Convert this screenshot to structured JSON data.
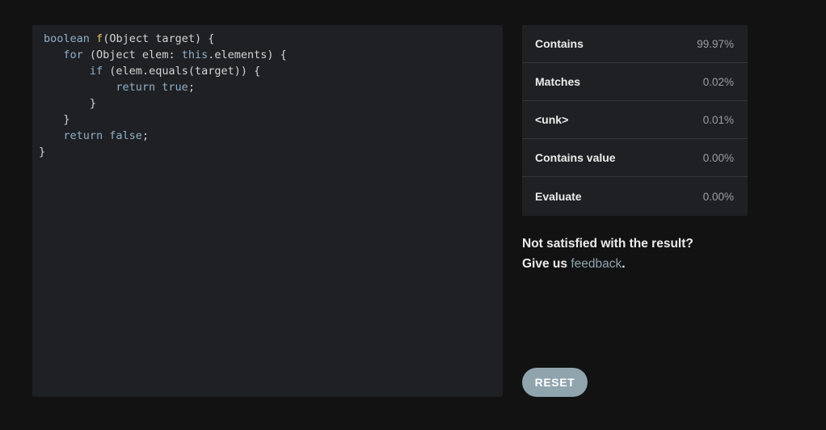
{
  "code": {
    "lines": [
      [
        {
          "t": "kw",
          "s": "boolean"
        },
        {
          "t": "plain",
          "s": " "
        },
        {
          "t": "fn",
          "s": "f"
        },
        {
          "t": "plain",
          "s": "(Object target) {"
        }
      ],
      [
        {
          "t": "plain",
          "s": "   "
        },
        {
          "t": "kw",
          "s": "for"
        },
        {
          "t": "plain",
          "s": " (Object elem: "
        },
        {
          "t": "kw",
          "s": "this"
        },
        {
          "t": "plain",
          "s": ".elements) {"
        }
      ],
      [
        {
          "t": "plain",
          "s": "       "
        },
        {
          "t": "kw",
          "s": "if"
        },
        {
          "t": "plain",
          "s": " (elem.equals(target)) {"
        }
      ],
      [
        {
          "t": "plain",
          "s": "           "
        },
        {
          "t": "kw",
          "s": "return true"
        },
        {
          "t": "plain",
          "s": ";"
        }
      ],
      [
        {
          "t": "plain",
          "s": "       }"
        }
      ],
      [
        {
          "t": "plain",
          "s": "   }"
        }
      ],
      [
        {
          "t": "plain",
          "s": "   "
        },
        {
          "t": "kw",
          "s": "return false"
        },
        {
          "t": "plain",
          "s": ";"
        }
      ],
      [
        {
          "t": "plain",
          "s": "}"
        }
      ]
    ]
  },
  "results": [
    {
      "name": "Contains",
      "pct": "99.97%"
    },
    {
      "name": "Matches",
      "pct": "0.02%"
    },
    {
      "name": "<unk>",
      "pct": "0.01%"
    },
    {
      "name": "Contains value",
      "pct": "0.00%"
    },
    {
      "name": "Evaluate",
      "pct": "0.00%"
    }
  ],
  "feedback": {
    "line1": "Not satisfied with the result?",
    "line2_prefix": "Give us",
    "link": "feedback",
    "line2_suffix": "."
  },
  "reset_label": "RESET",
  "colors": {
    "background": "#121212",
    "panel": "#1f2023",
    "keyword": "#8fb0cc",
    "function": "#e8c46b",
    "link": "#8fa5b1",
    "button": "#90a4ae"
  }
}
